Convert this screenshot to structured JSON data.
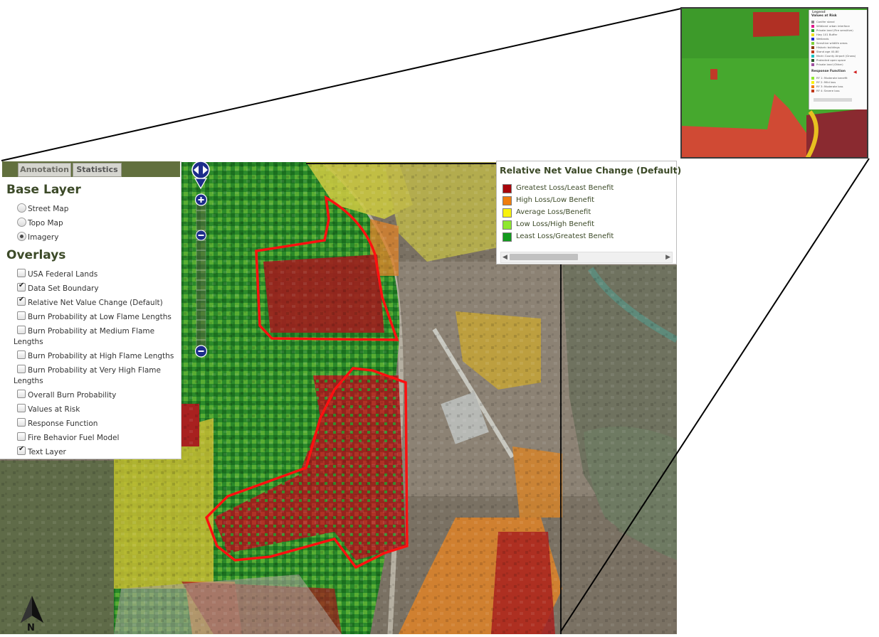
{
  "tabs": [
    {
      "label": "Annotation"
    },
    {
      "label": "Statistics"
    }
  ],
  "base_layer": {
    "title": "Base Layer",
    "options": [
      {
        "label": "Street Map",
        "selected": false
      },
      {
        "label": "Topo Map",
        "selected": false
      },
      {
        "label": "Imagery",
        "selected": true
      }
    ]
  },
  "overlays": {
    "title": "Overlays",
    "items": [
      {
        "label": "USA Federal Lands",
        "checked": false
      },
      {
        "label": "Data Set Boundary",
        "checked": true
      },
      {
        "label": "Relative Net Value Change (Default)",
        "checked": true
      },
      {
        "label": "Burn Probability at Low Flame Lengths",
        "checked": false
      },
      {
        "label": "Burn Probability at Medium Flame",
        "label_2": "Lengths",
        "checked": false
      },
      {
        "label": "Burn Probability at High Flame Lengths",
        "checked": false
      },
      {
        "label": "Burn Probability at Very High Flame",
        "label_2": "Lengths",
        "checked": false
      },
      {
        "label": "Overall Burn Probability",
        "checked": false
      },
      {
        "label": "Values at Risk",
        "checked": false
      },
      {
        "label": "Response Function",
        "checked": false
      },
      {
        "label": "Fire Behavior Fuel Model",
        "checked": false
      },
      {
        "label": "Text Layer",
        "checked": true
      }
    ]
  },
  "legend": {
    "title": "Relative Net Value Change (Default)",
    "items": [
      {
        "label": "Greatest Loss/Least Benefit",
        "color": "#a8060b"
      },
      {
        "label": "High Loss/Low Benefit",
        "color": "#ef7d0e"
      },
      {
        "label": "Average Loss/Benefit",
        "color": "#f8f20d"
      },
      {
        "label": "Low Loss/High Benefit",
        "color": "#8ee82f"
      },
      {
        "label": "Least Loss/Greatest Benefit",
        "color": "#139a1e"
      }
    ]
  },
  "inset": {
    "legend_title": "Values at Risk",
    "tab_label": "Legend",
    "items": [
      {
        "label": "Conifer stand",
        "color": "#8a8a8a"
      },
      {
        "label": "Wildland urban interface",
        "color": "#e01a8c"
      },
      {
        "label": "Private land (Fire sensitive)",
        "color": "#2ca02c"
      },
      {
        "label": "Hwy 101 Buffer",
        "color": "#f0e020"
      },
      {
        "label": "Wetlands",
        "color": "#1e2fd0"
      },
      {
        "label": "Sensitive wildlife areas",
        "color": "#7fd13a"
      },
      {
        "label": "Historic buildings",
        "color": "#8a3a10"
      },
      {
        "label": "Stand age 40-80",
        "color": "#c0391b"
      },
      {
        "label": "Marin County Airport (Gnoss)",
        "color": "#1bc0c0"
      },
      {
        "label": "Protected open space",
        "color": "#2a5a2a"
      },
      {
        "label": "Private land (Other)",
        "color": "#a050a0"
      }
    ],
    "rf_title": "Response Function",
    "rf_items": [
      {
        "label": "RF 1: Moderate benefit",
        "color": "#8ee82f"
      },
      {
        "label": "RF 2: Mild loss",
        "color": "#f8f20d"
      },
      {
        "label": "RF 3: Moderate loss",
        "color": "#ef7d0e"
      },
      {
        "label": "RF 4: Severe loss",
        "color": "#c0391b"
      }
    ]
  },
  "map": {
    "north_label": "N",
    "colors": {
      "red": "#a8211f",
      "orange": "#d9822a",
      "yellow": "#c9c640",
      "lightgreen": "#6dbb3a",
      "green": "#1f7f23",
      "outline": "#ff1010"
    }
  }
}
